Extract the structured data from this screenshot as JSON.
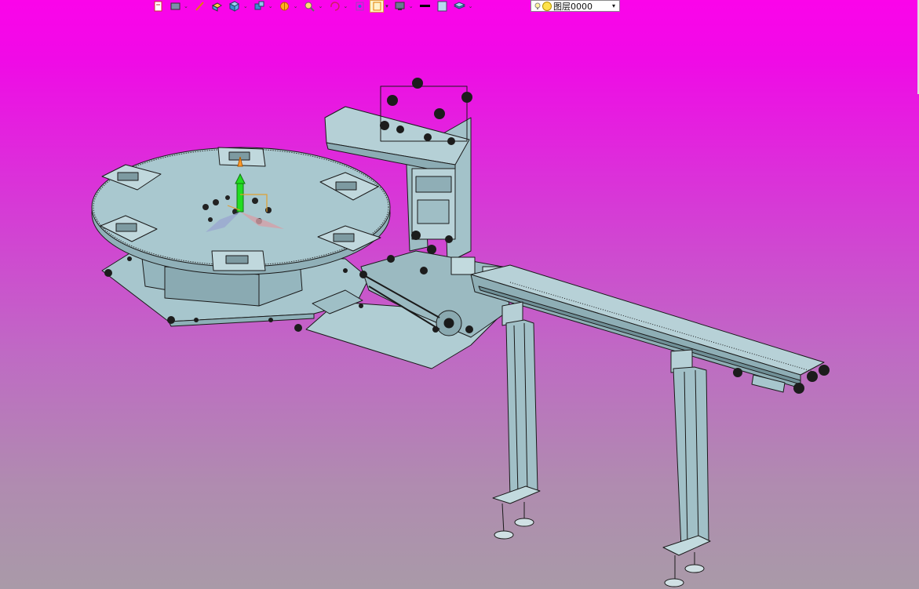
{
  "toolbar": {
    "icons": [
      "new-sheet-icon",
      "view-dropdown-icon",
      "pencil-icon",
      "box-open-icon",
      "cube-icon",
      "cube-group-icon",
      "sun-icon",
      "zoom-icon",
      "rotate-icon",
      "fit-icon",
      "frame-icon",
      "display-icon",
      "line-color-icon",
      "fill-color-icon",
      "layer-stack-icon"
    ],
    "colors": {
      "accent": "#ffcc66",
      "line": "#000000",
      "fill": "#b8d8f0"
    }
  },
  "layer": {
    "value": "图层0000"
  },
  "scene": {
    "background_top": "#fb04ea",
    "background_bottom": "#a99aa8",
    "part_color": "#a9c8cf",
    "edge_color": "#1c1c1c"
  }
}
